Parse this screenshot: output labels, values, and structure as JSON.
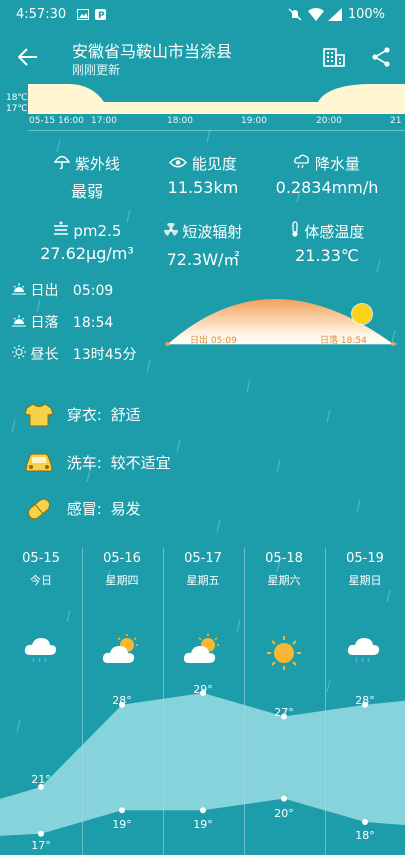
{
  "status_bar": {
    "time": "4:57:30",
    "battery": "100%"
  },
  "header": {
    "title": "安徽省马鞍山市当涂县",
    "subtitle": "刚刚更新"
  },
  "hourly": {
    "temp_labels": [
      "18℃",
      "17℃"
    ],
    "times": [
      "05-15 16:00",
      "17:00",
      "18:00",
      "19:00",
      "20:00",
      "21"
    ]
  },
  "metrics": [
    {
      "label": "紫外线",
      "value": "最弱",
      "icon": "umbrella-icon"
    },
    {
      "label": "能见度",
      "value": "11.53km",
      "icon": "eye-icon"
    },
    {
      "label": "降水量",
      "value": "0.2834mm/h",
      "icon": "rain-cloud-icon"
    },
    {
      "label": "pm2.5",
      "value": "27.62μg/m³",
      "icon": "haze-icon"
    },
    {
      "label": "短波辐射",
      "value": "72.3W/㎡",
      "icon": "radiation-icon"
    },
    {
      "label": "体感温度",
      "value": "21.33℃",
      "icon": "thermometer-icon"
    }
  ],
  "sun": {
    "sunrise_label": "日出",
    "sunrise": "05:09",
    "sunset_label": "日落",
    "sunset": "18:54",
    "daylength_label": "昼长",
    "daylength": "13时45分",
    "arc_sunrise": "日出 05:09",
    "arc_sunset": "日落 18:54"
  },
  "life": [
    {
      "label": "穿衣:",
      "value": "舒适",
      "icon": "shirt-icon"
    },
    {
      "label": "洗车:",
      "value": "较不适宜",
      "icon": "car-icon"
    },
    {
      "label": "感冒:",
      "value": "易发",
      "icon": "pill-icon"
    }
  ],
  "forecast": [
    {
      "date": "05-15",
      "weekday": "今日",
      "weather": "rain",
      "high": "21°",
      "low": "17°"
    },
    {
      "date": "05-16",
      "weekday": "星期四",
      "weather": "partly-cloudy",
      "high": "28°",
      "low": "19°"
    },
    {
      "date": "05-17",
      "weekday": "星期五",
      "weather": "partly-cloudy",
      "high": "29°",
      "low": "19°"
    },
    {
      "date": "05-18",
      "weekday": "星期六",
      "weather": "sunny",
      "high": "27°",
      "low": "20°"
    },
    {
      "date": "05-19",
      "weekday": "星期日",
      "weather": "rain",
      "high": "28°",
      "low": "18°"
    }
  ],
  "colors": {
    "background": "#1d9daa",
    "sun_arc": "#f6a75c",
    "sun": "#ffd21a",
    "band": "#9adde4",
    "strip": "#fff7d2"
  }
}
